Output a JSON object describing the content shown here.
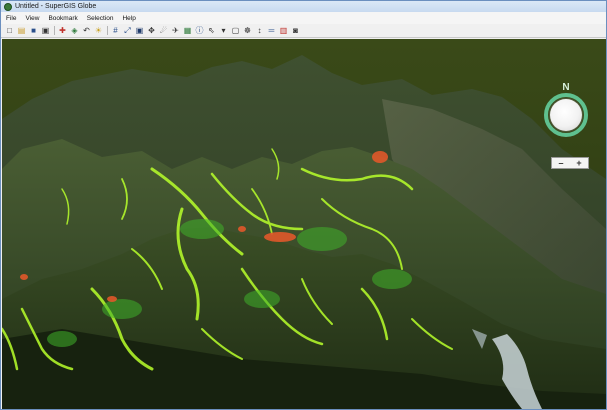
{
  "window": {
    "title": "Untitled - SuperGIS Globe"
  },
  "menu": [
    {
      "label": "File"
    },
    {
      "label": "View"
    },
    {
      "label": "Bookmark"
    },
    {
      "label": "Selection"
    },
    {
      "label": "Help"
    }
  ],
  "toolbar": {
    "buttons": [
      {
        "name": "new-icon",
        "glyph": "□"
      },
      {
        "name": "open-icon",
        "glyph": "▤"
      },
      {
        "name": "save-icon",
        "glyph": "■"
      },
      {
        "name": "print-icon",
        "glyph": "▣"
      },
      {
        "name": "add-layer-icon",
        "glyph": "✚"
      },
      {
        "name": "layer-tools-icon",
        "glyph": "◈"
      },
      {
        "name": "undo-icon",
        "glyph": "↶"
      },
      {
        "name": "bulb-icon",
        "glyph": "☀"
      },
      {
        "name": "grid-icon",
        "glyph": "#"
      },
      {
        "name": "full-extent-icon",
        "glyph": "⤢"
      },
      {
        "name": "zoom-box-icon",
        "glyph": "▣"
      },
      {
        "name": "pan-icon",
        "glyph": "✥"
      },
      {
        "name": "navigate-icon",
        "glyph": "☄"
      },
      {
        "name": "fly-icon",
        "glyph": "✈"
      },
      {
        "name": "map-icon",
        "glyph": "▦"
      },
      {
        "name": "identify-icon",
        "glyph": "ⓘ"
      },
      {
        "name": "select-icon",
        "glyph": "⇖"
      },
      {
        "name": "dropdown-icon",
        "glyph": "▾"
      },
      {
        "name": "clear-selection-icon",
        "glyph": "▢"
      },
      {
        "name": "find-icon",
        "glyph": "☸"
      },
      {
        "name": "measure-icon",
        "glyph": "↕"
      },
      {
        "name": "ruler-icon",
        "glyph": "═"
      },
      {
        "name": "bookmark-icon",
        "glyph": "▥"
      },
      {
        "name": "camera-icon",
        "glyph": "◙"
      }
    ]
  },
  "compass": {
    "north_label": "N",
    "ring_color": "#5fc08f"
  },
  "zoom": {
    "minus_label": "–",
    "plus_label": "+"
  },
  "colors": {
    "sky": "#2f3d14",
    "terrain_dark": "#2b3b22",
    "terrain_light": "#4f6130",
    "vegetation_highlight": "#b8ff2b",
    "hotspot": "#e0582a",
    "water": "#c9d5d8"
  }
}
